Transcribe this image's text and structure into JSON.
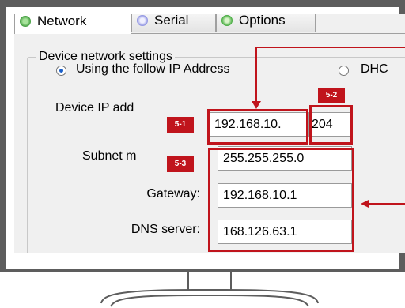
{
  "tabs": [
    {
      "label": "Network",
      "active": true,
      "icon": "network-icon"
    },
    {
      "label": "Serial",
      "active": false,
      "icon": "serial-icon"
    },
    {
      "label": "Options",
      "active": false,
      "icon": "options-icon"
    }
  ],
  "group_title": "Device network settings",
  "radios": {
    "static": {
      "label": "Using the follow IP Address",
      "selected": true
    },
    "dhcp": {
      "label": "DHC",
      "selected": false
    }
  },
  "fields": {
    "device_ip": {
      "label": "Device IP add",
      "value1": "192.168.10.",
      "value2": "204"
    },
    "subnet": {
      "label": "Subnet m",
      "value": "255.255.255.0"
    },
    "gateway": {
      "label": "Gateway:",
      "value": "192.168.10.1"
    },
    "dns": {
      "label": "DNS server:",
      "value": "168.126.63.1"
    }
  },
  "annotations": {
    "tag_5_1": "5-1",
    "tag_5_2": "5-2",
    "tag_5_3": "5-3",
    "color": "#c0141c"
  },
  "colors": {
    "frame": "#5d5d5d",
    "window_bg": "#f0f0f0",
    "accent_red": "#c0141c"
  }
}
